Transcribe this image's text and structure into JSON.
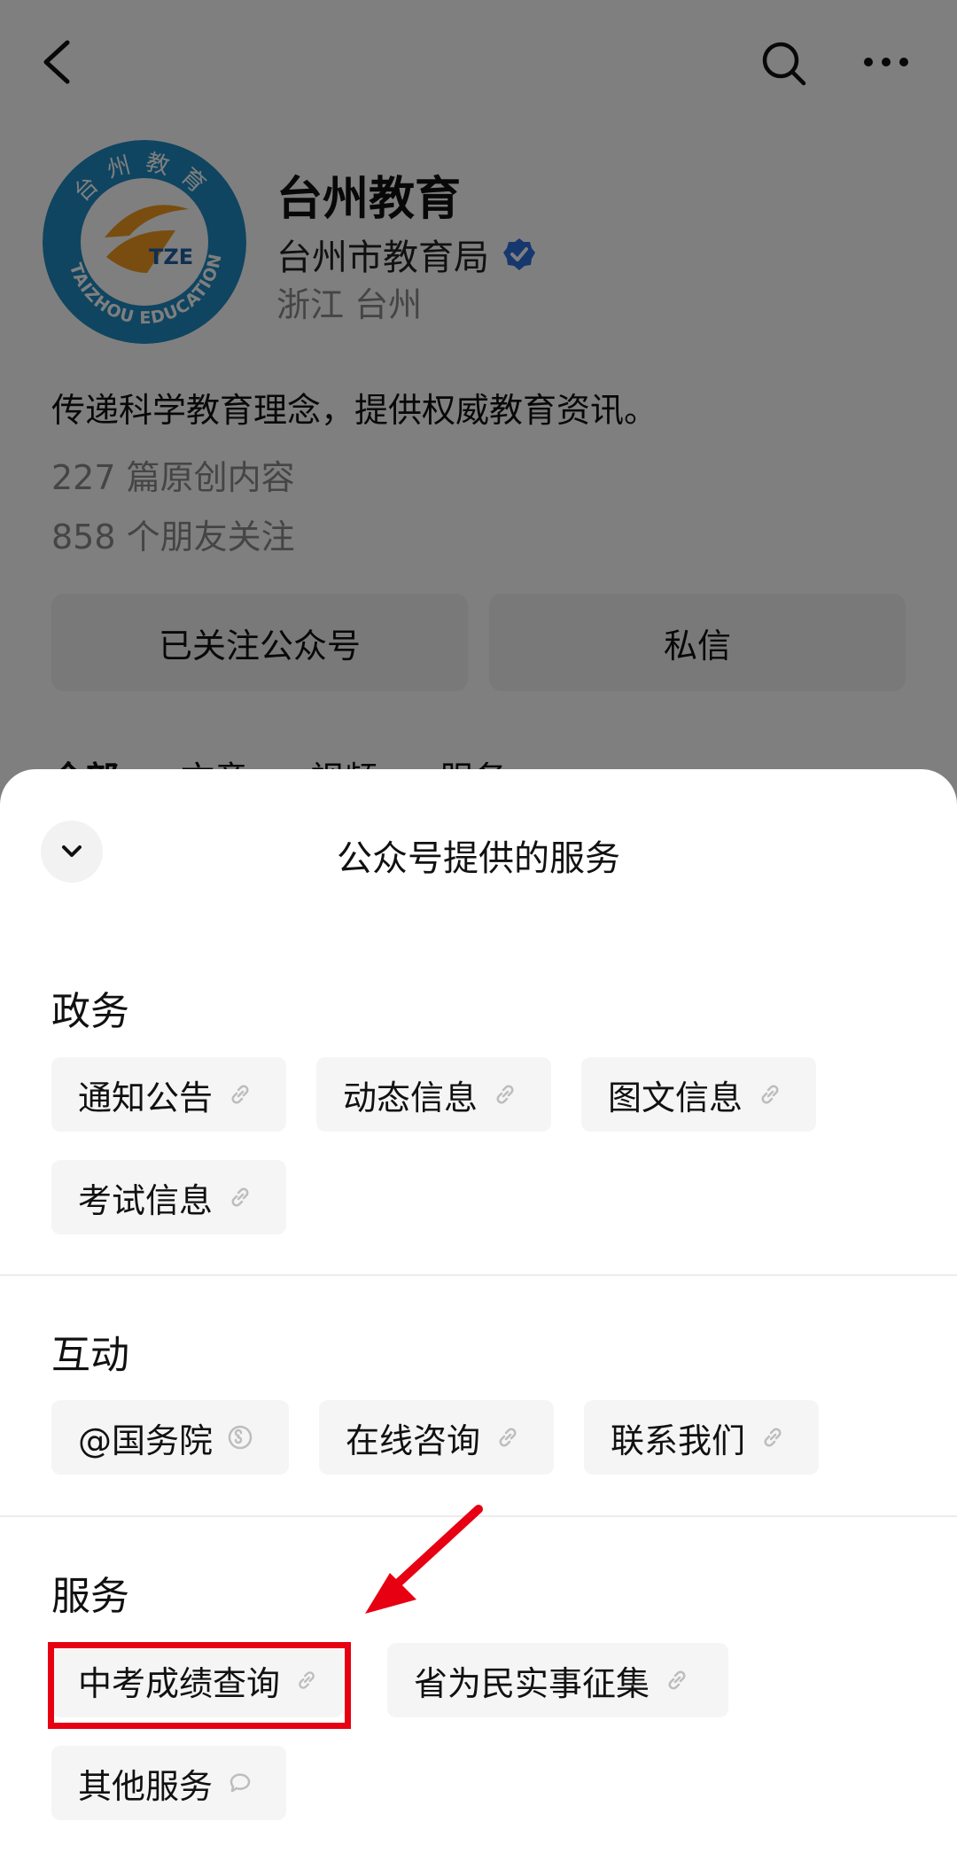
{
  "topbar": {
    "back_icon": "chevron-left-icon",
    "search_icon": "search-icon",
    "more_icon": "more-dots-icon"
  },
  "profile": {
    "name": "台州教育",
    "org": "台州市教育局",
    "location": "浙江 台州",
    "description": "传递科学教育理念，提供权威教育资讯。",
    "original_count": "227 篇原创内容",
    "followers": "858 个朋友关注",
    "logo": {
      "top_text": "台州教育",
      "bottom_text": "TAIZHOU EDUCATION",
      "center_text": "TZE"
    }
  },
  "actions": {
    "followed_label": "已关注公众号",
    "message_label": "私信"
  },
  "tabs": [
    "全部",
    "文章",
    "视频",
    "服务"
  ],
  "sheet": {
    "title": "公众号提供的服务",
    "sections": [
      {
        "title": "政务",
        "items": [
          {
            "label": "通知公告",
            "icon": "link-icon"
          },
          {
            "label": "动态信息",
            "icon": "link-icon"
          },
          {
            "label": "图文信息",
            "icon": "link-icon"
          },
          {
            "label": "考试信息",
            "icon": "link-icon"
          }
        ]
      },
      {
        "title": "互动",
        "items": [
          {
            "label": "@国务院",
            "icon": "miniprogram-icon"
          },
          {
            "label": "在线咨询",
            "icon": "link-icon"
          },
          {
            "label": "联系我们",
            "icon": "link-icon"
          }
        ]
      },
      {
        "title": "服务",
        "items": [
          {
            "label": "中考成绩查询",
            "icon": "link-icon"
          },
          {
            "label": "省为民实事征集",
            "icon": "link-icon"
          },
          {
            "label": "其他服务",
            "icon": "chat-bubble-icon"
          }
        ]
      }
    ]
  },
  "colors": {
    "accent_red": "#e60012",
    "verified_blue": "#2f6fde",
    "logo_blue": "#1f8ac0",
    "logo_orange": "#f29a1f"
  }
}
